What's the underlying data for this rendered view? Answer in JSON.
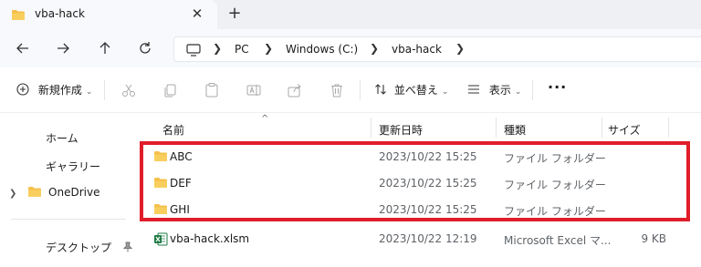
{
  "tab": {
    "title": "vba-hack",
    "close_glyph": "✕",
    "new_tab_glyph": "+"
  },
  "breadcrumb": [
    "PC",
    "Windows (C:)",
    "vba-hack"
  ],
  "toolbar": {
    "new_label": "新規作成",
    "sort_label": "並べ替え",
    "view_label": "表示",
    "more_label": "···",
    "icons": [
      "cut-icon",
      "copy-icon",
      "paste-icon",
      "rename-icon",
      "share-icon",
      "delete-icon"
    ]
  },
  "sidebar": {
    "items": [
      {
        "label": "ホーム"
      },
      {
        "label": "ギャラリー"
      },
      {
        "label": "OneDrive"
      },
      {
        "label": "デスクトップ"
      }
    ]
  },
  "columns": {
    "name": "名前",
    "date": "更新日時",
    "type": "種類",
    "size": "サイズ"
  },
  "files": [
    {
      "name": "ABC",
      "date": "2023/10/22 15:25",
      "type": "ファイル フォルダー",
      "size": "",
      "icon": "folder-icon"
    },
    {
      "name": "DEF",
      "date": "2023/10/22 15:25",
      "type": "ファイル フォルダー",
      "size": "",
      "icon": "folder-icon"
    },
    {
      "name": "GHI",
      "date": "2023/10/22 15:25",
      "type": "ファイル フォルダー",
      "size": "",
      "icon": "folder-icon"
    },
    {
      "name": "vba-hack.xlsm",
      "date": "2023/10/22 12:19",
      "type": "Microsoft Excel マ...",
      "size": "9 KB",
      "icon": "excel-file-icon"
    }
  ],
  "colors": {
    "accent_highlight": "#e11d2a",
    "folder": "#f5c04a",
    "excel": "#1d7a45"
  }
}
